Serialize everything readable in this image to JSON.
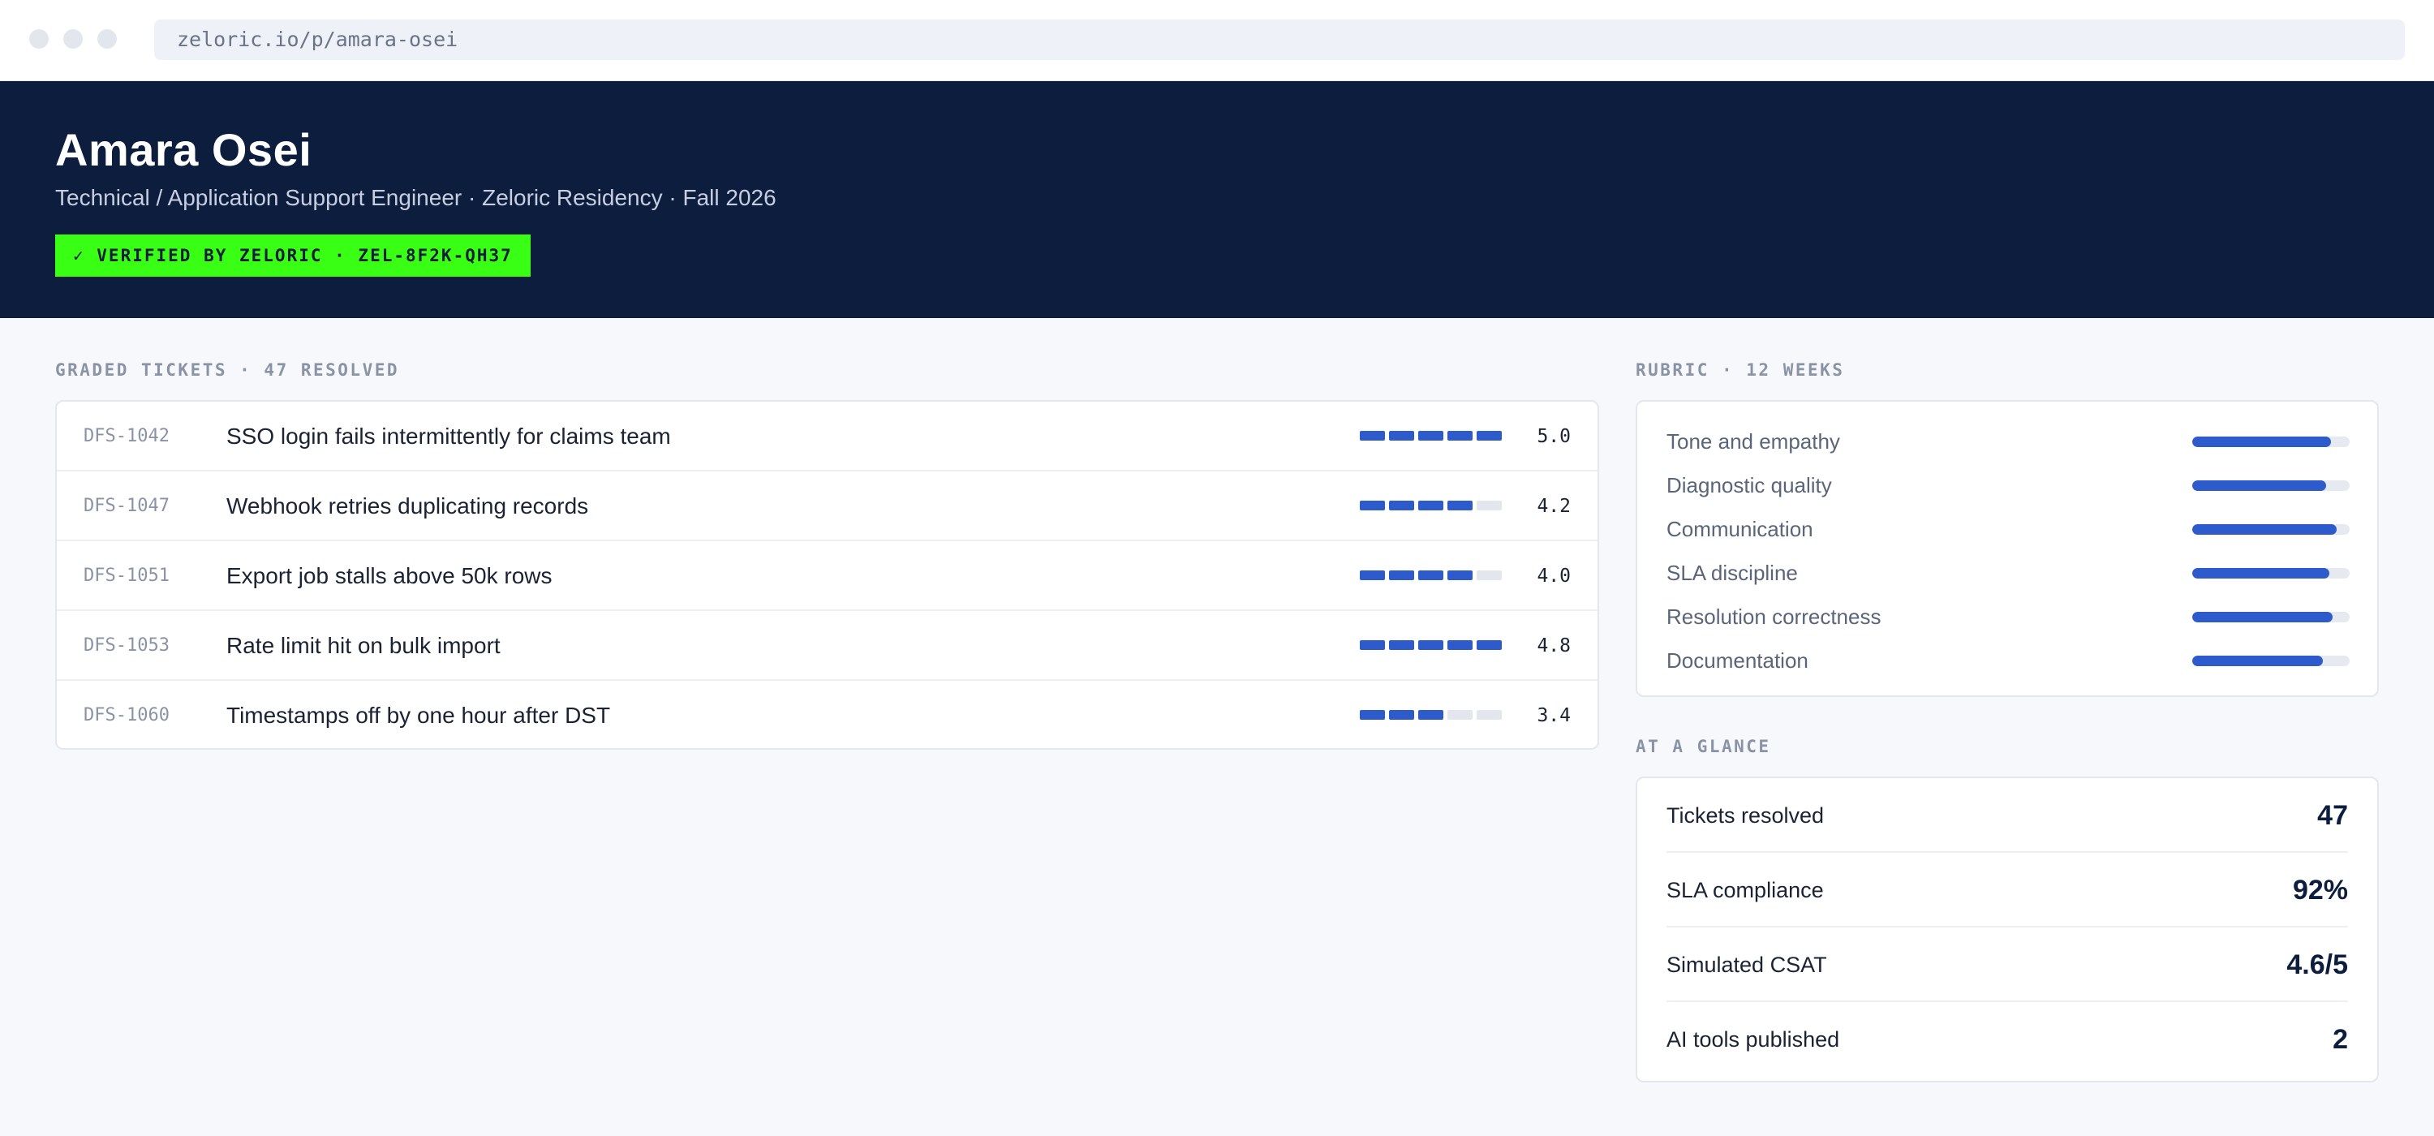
{
  "browser": {
    "url": "zeloric.io/p/amara-osei"
  },
  "profile": {
    "name": "Amara Osei",
    "subtitle": "Technical / Application Support Engineer · Zeloric Residency · Fall 2026",
    "badge": "✓ VERIFIED BY ZELORIC · ZEL-8F2K-QH37"
  },
  "tickets": {
    "heading": "GRADED TICKETS · 47 RESOLVED",
    "max_segments": 5,
    "items": [
      {
        "id": "DFS-1042",
        "title": "SSO login fails intermittently for claims team",
        "filled_segments": 5,
        "score": "5.0"
      },
      {
        "id": "DFS-1047",
        "title": "Webhook retries duplicating records",
        "filled_segments": 4,
        "score": "4.2"
      },
      {
        "id": "DFS-1051",
        "title": "Export job stalls above 50k rows",
        "filled_segments": 4,
        "score": "4.0"
      },
      {
        "id": "DFS-1053",
        "title": "Rate limit hit on bulk import",
        "filled_segments": 5,
        "score": "4.8"
      },
      {
        "id": "DFS-1060",
        "title": "Timestamps off by one hour after DST",
        "filled_segments": 3,
        "score": "3.4"
      }
    ]
  },
  "rubric": {
    "heading": "RUBRIC · 12 WEEKS",
    "items": [
      {
        "label": "Tone and empathy",
        "level": 0.88
      },
      {
        "label": "Diagnostic quality",
        "level": 0.85
      },
      {
        "label": "Communication",
        "level": 0.92
      },
      {
        "label": "SLA discipline",
        "level": 0.87
      },
      {
        "label": "Resolution correctness",
        "level": 0.89
      },
      {
        "label": "Documentation",
        "level": 0.83
      }
    ]
  },
  "glance": {
    "heading": "AT A GLANCE",
    "items": [
      {
        "label": "Tickets resolved",
        "value": "47"
      },
      {
        "label": "SLA compliance",
        "value": "92%"
      },
      {
        "label": "Simulated CSAT",
        "value": "4.6/5"
      },
      {
        "label": "AI tools published",
        "value": "2"
      }
    ]
  },
  "colors": {
    "hero_bg": "#0d1d3e",
    "badge_bg": "#39ff14",
    "accent": "#2e5bcc",
    "track": "#e3e6ec"
  }
}
